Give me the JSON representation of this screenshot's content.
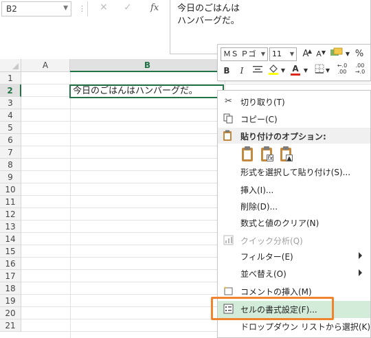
{
  "formula_bar": {
    "name_box": "B2",
    "cancel_glyph": "✕",
    "enter_glyph": "✓",
    "fx_label": "fx",
    "content_line1": "今日のごはんは",
    "content_line2": "ハンバーグだ。"
  },
  "grid": {
    "columns": [
      "A",
      "B"
    ],
    "rows": [
      "1",
      "2",
      "3",
      "4",
      "5",
      "6",
      "7",
      "8",
      "9",
      "10",
      "11",
      "12",
      "13",
      "14",
      "15",
      "16",
      "17",
      "18",
      "19",
      "20",
      "21"
    ],
    "selected_cell_value": "今日のごはんはハンバーグだ。"
  },
  "mini_toolbar": {
    "font_name": "ＭＳ Ｐゴ",
    "font_size": "11",
    "grow_font": "A",
    "shrink_font": "A",
    "percent": "%",
    "comma": ",",
    "bold": "B",
    "italic": "I",
    "font_color_glyph": "A",
    "increase_decimal": "←.0\n.00",
    "decrease_decimal": ".00\n→.0"
  },
  "context_menu": {
    "cut": "切り取り(T)",
    "copy": "コピー(C)",
    "paste_options_header": "貼り付けのオプション:",
    "paste_special": "形式を選択して貼り付け(S)...",
    "insert": "挿入(I)...",
    "delete": "削除(D)...",
    "clear_contents": "数式と値のクリア(N)",
    "quick_analysis": "クイック分析(Q)",
    "filter": "フィルター(E)",
    "sort": "並べ替え(O)",
    "insert_comment": "コメントの挿入(M)",
    "format_cells": "セルの書式設定(F)...",
    "pick_from_dropdown": "ドロップダウン リストから選択(K)..."
  },
  "colors": {
    "excel_green": "#217346",
    "highlight": "#d3ecd9",
    "annotation_orange": "#f0832d"
  }
}
